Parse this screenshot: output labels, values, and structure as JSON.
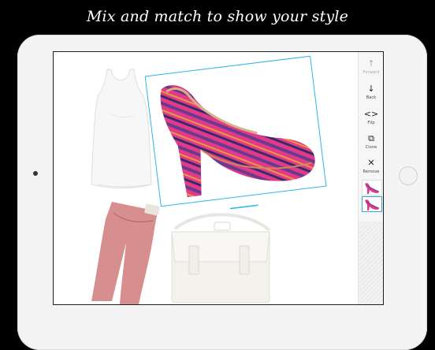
{
  "headline": "Mix and match to show your style",
  "toolbar": {
    "forward": {
      "label": "Forward",
      "icon": "arrow-up-icon",
      "enabled": false
    },
    "back": {
      "label": "Back",
      "icon": "arrow-down-icon",
      "enabled": true
    },
    "flip": {
      "label": "Flip",
      "icon": "flip-icon",
      "enabled": true
    },
    "clone": {
      "label": "Clone",
      "icon": "clone-icon",
      "enabled": true
    },
    "remove": {
      "label": "Remove",
      "icon": "close-icon",
      "enabled": true
    }
  },
  "colors": {
    "selection": "#27b6e6",
    "shoe_pink": "#e23a8a",
    "shoe_purple": "#6a3a8c",
    "jeans": "#c96a6a",
    "tank": "#f4f4f4",
    "bag": "#f1efea"
  },
  "layers": [
    "tank-top",
    "jeans",
    "satchel-bag",
    "pink-pump"
  ],
  "selected_layer": "pink-pump"
}
